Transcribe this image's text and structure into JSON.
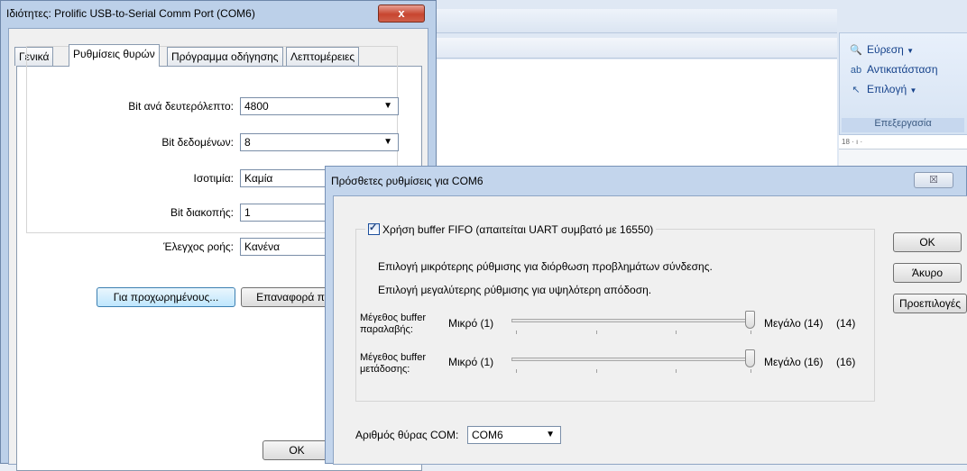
{
  "word_window": {
    "ribbon": {
      "find_label": "Εύρεση",
      "replace_label": "Αντικατάσταση",
      "select_label": "Επιλογή",
      "group_label": "Επεξεργασία"
    },
    "ruler_text": "18 · ı ·"
  },
  "properties_dialog": {
    "title": "Ιδιότητες: Prolific USB-to-Serial Comm Port (COM6)",
    "close_glyph": "x",
    "tabs": [
      {
        "label": "Γενικά"
      },
      {
        "label": "Ρυθμίσεις θυρών"
      },
      {
        "label": "Πρόγραμμα οδήγησης"
      },
      {
        "label": "Λεπτομέρειες"
      }
    ],
    "active_tab": "Ρυθμίσεις θυρών",
    "fields": [
      {
        "label": "Bit ανά δευτερόλεπτο:",
        "value": "4800"
      },
      {
        "label": "Bit δεδομένων:",
        "value": "8"
      },
      {
        "label": "Ισοτιμία:",
        "value": "Καμία"
      },
      {
        "label": "Bit διακοπής:",
        "value": "1"
      },
      {
        "label": "Έλεγχος ροής:",
        "value": "Κανένα"
      }
    ],
    "advanced_button": "Για προχωρημένους...",
    "restore_button": "Επαναφορά π",
    "ok_button": "OK"
  },
  "advanced_dialog": {
    "title": "Πρόσθετες ρυθμίσεις για COM6",
    "close_glyph": "☒",
    "fifo_checkbox_label": "Χρήση buffer FIFO (απαιτείται UART συμβατό με 16550)",
    "fifo_checked": true,
    "hint_low": "Επιλογή μικρότερης ρύθμισης για διόρθωση προβλημάτων σύνδεσης.",
    "hint_high": "Επιλογή μεγαλύτερης ρύθμισης για υψηλότερη απόδοση.",
    "receive": {
      "label_line1": "Μέγεθος buffer",
      "label_line2": "παραλαβής:",
      "min_label": "Μικρό (1)",
      "max_label": "Μεγάλο (14)",
      "value": "(14)",
      "level_fraction": 1.0
    },
    "transmit": {
      "label_line1": "Μέγεθος buffer",
      "label_line2": "μετάδοσης:",
      "min_label": "Μικρό (1)",
      "max_label": "Μεγάλο (16)",
      "value": "(16)",
      "level_fraction": 1.0
    },
    "com_port_label": "Αριθμός θύρας COM:",
    "com_port_value": "COM6",
    "ok_button": "OK",
    "cancel_button": "Άκυρο",
    "defaults_button": "Προεπιλογές"
  }
}
